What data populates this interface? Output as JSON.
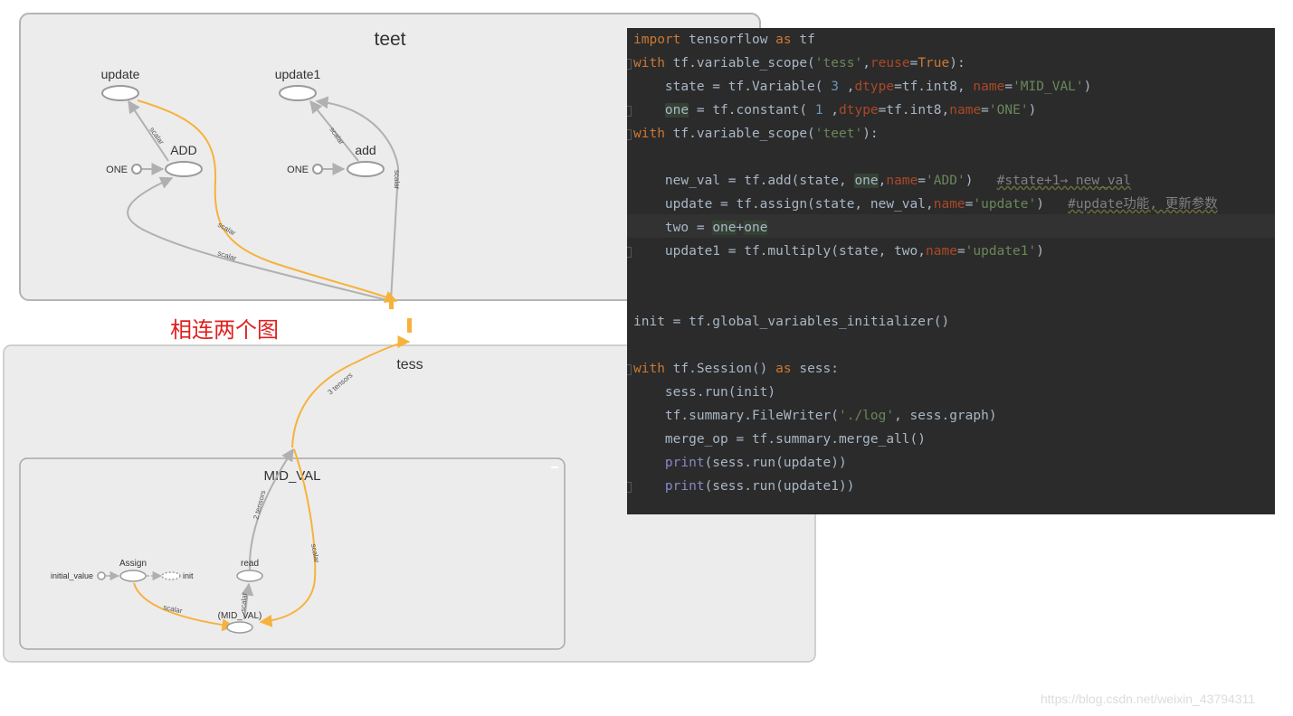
{
  "graph": {
    "teet": {
      "title": "teet",
      "nodes": {
        "update": "update",
        "update1": "update1",
        "add_upper": "ADD",
        "add_lower": "add",
        "one_left": "ONE",
        "one_right": "ONE"
      },
      "edge_labels": {
        "scalar": "scalar"
      }
    },
    "tess": {
      "title": "tess",
      "inner": {
        "title": "MID_VAL",
        "nodes": {
          "assign": "Assign",
          "read": "read",
          "initial_value": "initial_value",
          "init": "init",
          "mid_val": "(MID_VAL)"
        },
        "edge_labels": {
          "scalar": "scalar",
          "tensors": "2 tensors"
        }
      },
      "edge_labels": {
        "tensors3": "3 tensors"
      }
    }
  },
  "annotation": "相连两个图",
  "code": {
    "lines": [
      [
        [
          "kw",
          "import"
        ],
        [
          "t",
          " tensorflow "
        ],
        [
          "kw",
          "as"
        ],
        [
          "t",
          " tf"
        ]
      ],
      [
        [
          "kw",
          "with"
        ],
        [
          "t",
          " tf.variable_scope("
        ],
        [
          "str",
          "'tess'"
        ],
        [
          "t",
          ","
        ],
        [
          "param",
          "reuse"
        ],
        [
          "t",
          "="
        ],
        [
          "kw",
          "True"
        ],
        [
          "t",
          "):"
        ]
      ],
      [
        [
          "t",
          "    state = tf.Variable( "
        ],
        [
          "num",
          "3"
        ],
        [
          "t",
          " ,"
        ],
        [
          "param",
          "dtype"
        ],
        [
          "t",
          "=tf.int8, "
        ],
        [
          "param",
          "name"
        ],
        [
          "t",
          "="
        ],
        [
          "str",
          "'MID_VAL'"
        ],
        [
          "t",
          ")"
        ]
      ],
      [
        [
          "t",
          "    "
        ],
        [
          "hl",
          "one"
        ],
        [
          "t",
          " = tf.constant( "
        ],
        [
          "num",
          "1"
        ],
        [
          "t",
          " ,"
        ],
        [
          "param",
          "dtype"
        ],
        [
          "t",
          "=tf.int8,"
        ],
        [
          "param",
          "name"
        ],
        [
          "t",
          "="
        ],
        [
          "str",
          "'ONE'"
        ],
        [
          "t",
          ")"
        ]
      ],
      [
        [
          "kw",
          "with"
        ],
        [
          "t",
          " tf.variable_scope("
        ],
        [
          "str",
          "'teet'"
        ],
        [
          "t",
          "):"
        ]
      ],
      [
        [
          "t",
          ""
        ]
      ],
      [
        [
          "t",
          "    new_val = tf.add(state, "
        ],
        [
          "hl",
          "one"
        ],
        [
          "t",
          ","
        ],
        [
          "param",
          "name"
        ],
        [
          "t",
          "="
        ],
        [
          "str",
          "'ADD'"
        ],
        [
          "t",
          ")   "
        ],
        [
          "cmt",
          "#state+1→ new_val"
        ]
      ],
      [
        [
          "t",
          "    update = tf.assign(state, new_val,"
        ],
        [
          "param",
          "name"
        ],
        [
          "t",
          "="
        ],
        [
          "str",
          "'update'"
        ],
        [
          "t",
          ")   "
        ],
        [
          "cmt",
          "#update功能, 更新参数"
        ]
      ],
      [
        [
          "t",
          "    two = "
        ],
        [
          "hl",
          "one"
        ],
        [
          "t",
          "+"
        ],
        [
          "hl",
          "one"
        ]
      ],
      [
        [
          "t",
          "    update1 = tf.multiply(state, two,"
        ],
        [
          "param",
          "name"
        ],
        [
          "t",
          "="
        ],
        [
          "str",
          "'update1'"
        ],
        [
          "t",
          ")"
        ]
      ],
      [
        [
          "t",
          ""
        ]
      ],
      [
        [
          "t",
          ""
        ]
      ],
      [
        [
          "t",
          "init = tf.global_variables_initializer()"
        ]
      ],
      [
        [
          "t",
          ""
        ]
      ],
      [
        [
          "kw",
          "with"
        ],
        [
          "t",
          " tf.Session() "
        ],
        [
          "kw",
          "as"
        ],
        [
          "t",
          " sess:"
        ]
      ],
      [
        [
          "t",
          "    sess.run(init)"
        ]
      ],
      [
        [
          "t",
          "    tf.summary.FileWriter("
        ],
        [
          "str",
          "'./log'"
        ],
        [
          "t",
          ", sess.graph)"
        ]
      ],
      [
        [
          "t",
          "    merge_op = tf.summary.merge_all()"
        ]
      ],
      [
        [
          "t",
          "    "
        ],
        [
          "fn",
          "print"
        ],
        [
          "t",
          "(sess.run(update))"
        ]
      ],
      [
        [
          "t",
          "    "
        ],
        [
          "fn",
          "print"
        ],
        [
          "t",
          "(sess.run(update1))"
        ]
      ]
    ]
  },
  "watermark": "https://blog.csdn.net/weixin_43794311",
  "colors": {
    "panel_bg": "#ececec",
    "panel_border": "#b4b4b4",
    "node_stroke": "#9a9a9a",
    "edge_gray": "#b0b0b0",
    "edge_orange": "#f7b23b",
    "annotation": "#e02020",
    "code_bg": "#2b2b2b"
  }
}
